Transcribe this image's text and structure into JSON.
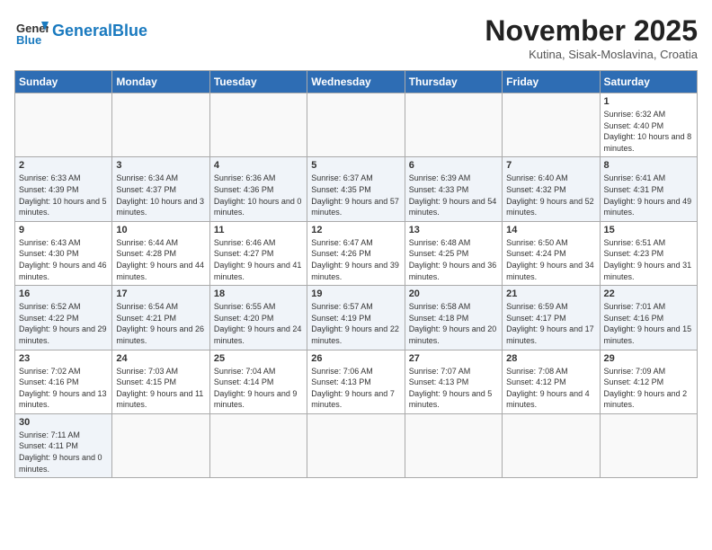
{
  "header": {
    "logo_general": "General",
    "logo_blue": "Blue",
    "month_title": "November 2025",
    "subtitle": "Kutina, Sisak-Moslavina, Croatia"
  },
  "days_of_week": [
    "Sunday",
    "Monday",
    "Tuesday",
    "Wednesday",
    "Thursday",
    "Friday",
    "Saturday"
  ],
  "weeks": [
    [
      {
        "day": "",
        "info": ""
      },
      {
        "day": "",
        "info": ""
      },
      {
        "day": "",
        "info": ""
      },
      {
        "day": "",
        "info": ""
      },
      {
        "day": "",
        "info": ""
      },
      {
        "day": "",
        "info": ""
      },
      {
        "day": "1",
        "info": "Sunrise: 6:32 AM\nSunset: 4:40 PM\nDaylight: 10 hours and 8 minutes."
      }
    ],
    [
      {
        "day": "2",
        "info": "Sunrise: 6:33 AM\nSunset: 4:39 PM\nDaylight: 10 hours and 5 minutes."
      },
      {
        "day": "3",
        "info": "Sunrise: 6:34 AM\nSunset: 4:37 PM\nDaylight: 10 hours and 3 minutes."
      },
      {
        "day": "4",
        "info": "Sunrise: 6:36 AM\nSunset: 4:36 PM\nDaylight: 10 hours and 0 minutes."
      },
      {
        "day": "5",
        "info": "Sunrise: 6:37 AM\nSunset: 4:35 PM\nDaylight: 9 hours and 57 minutes."
      },
      {
        "day": "6",
        "info": "Sunrise: 6:39 AM\nSunset: 4:33 PM\nDaylight: 9 hours and 54 minutes."
      },
      {
        "day": "7",
        "info": "Sunrise: 6:40 AM\nSunset: 4:32 PM\nDaylight: 9 hours and 52 minutes."
      },
      {
        "day": "8",
        "info": "Sunrise: 6:41 AM\nSunset: 4:31 PM\nDaylight: 9 hours and 49 minutes."
      }
    ],
    [
      {
        "day": "9",
        "info": "Sunrise: 6:43 AM\nSunset: 4:30 PM\nDaylight: 9 hours and 46 minutes."
      },
      {
        "day": "10",
        "info": "Sunrise: 6:44 AM\nSunset: 4:28 PM\nDaylight: 9 hours and 44 minutes."
      },
      {
        "day": "11",
        "info": "Sunrise: 6:46 AM\nSunset: 4:27 PM\nDaylight: 9 hours and 41 minutes."
      },
      {
        "day": "12",
        "info": "Sunrise: 6:47 AM\nSunset: 4:26 PM\nDaylight: 9 hours and 39 minutes."
      },
      {
        "day": "13",
        "info": "Sunrise: 6:48 AM\nSunset: 4:25 PM\nDaylight: 9 hours and 36 minutes."
      },
      {
        "day": "14",
        "info": "Sunrise: 6:50 AM\nSunset: 4:24 PM\nDaylight: 9 hours and 34 minutes."
      },
      {
        "day": "15",
        "info": "Sunrise: 6:51 AM\nSunset: 4:23 PM\nDaylight: 9 hours and 31 minutes."
      }
    ],
    [
      {
        "day": "16",
        "info": "Sunrise: 6:52 AM\nSunset: 4:22 PM\nDaylight: 9 hours and 29 minutes."
      },
      {
        "day": "17",
        "info": "Sunrise: 6:54 AM\nSunset: 4:21 PM\nDaylight: 9 hours and 26 minutes."
      },
      {
        "day": "18",
        "info": "Sunrise: 6:55 AM\nSunset: 4:20 PM\nDaylight: 9 hours and 24 minutes."
      },
      {
        "day": "19",
        "info": "Sunrise: 6:57 AM\nSunset: 4:19 PM\nDaylight: 9 hours and 22 minutes."
      },
      {
        "day": "20",
        "info": "Sunrise: 6:58 AM\nSunset: 4:18 PM\nDaylight: 9 hours and 20 minutes."
      },
      {
        "day": "21",
        "info": "Sunrise: 6:59 AM\nSunset: 4:17 PM\nDaylight: 9 hours and 17 minutes."
      },
      {
        "day": "22",
        "info": "Sunrise: 7:01 AM\nSunset: 4:16 PM\nDaylight: 9 hours and 15 minutes."
      }
    ],
    [
      {
        "day": "23",
        "info": "Sunrise: 7:02 AM\nSunset: 4:16 PM\nDaylight: 9 hours and 13 minutes."
      },
      {
        "day": "24",
        "info": "Sunrise: 7:03 AM\nSunset: 4:15 PM\nDaylight: 9 hours and 11 minutes."
      },
      {
        "day": "25",
        "info": "Sunrise: 7:04 AM\nSunset: 4:14 PM\nDaylight: 9 hours and 9 minutes."
      },
      {
        "day": "26",
        "info": "Sunrise: 7:06 AM\nSunset: 4:13 PM\nDaylight: 9 hours and 7 minutes."
      },
      {
        "day": "27",
        "info": "Sunrise: 7:07 AM\nSunset: 4:13 PM\nDaylight: 9 hours and 5 minutes."
      },
      {
        "day": "28",
        "info": "Sunrise: 7:08 AM\nSunset: 4:12 PM\nDaylight: 9 hours and 4 minutes."
      },
      {
        "day": "29",
        "info": "Sunrise: 7:09 AM\nSunset: 4:12 PM\nDaylight: 9 hours and 2 minutes."
      }
    ],
    [
      {
        "day": "30",
        "info": "Sunrise: 7:11 AM\nSunset: 4:11 PM\nDaylight: 9 hours and 0 minutes."
      },
      {
        "day": "",
        "info": ""
      },
      {
        "day": "",
        "info": ""
      },
      {
        "day": "",
        "info": ""
      },
      {
        "day": "",
        "info": ""
      },
      {
        "day": "",
        "info": ""
      },
      {
        "day": "",
        "info": ""
      }
    ]
  ]
}
